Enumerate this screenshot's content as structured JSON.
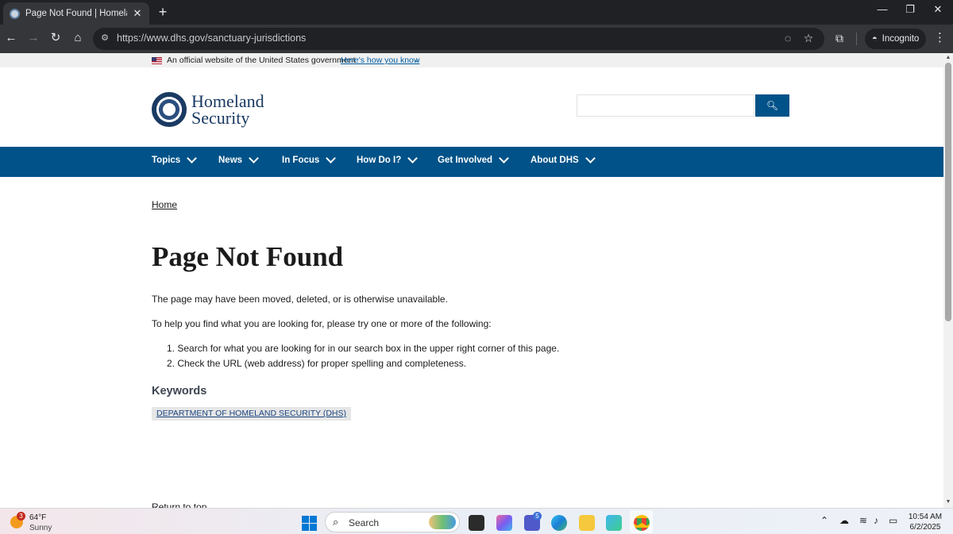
{
  "browser": {
    "tab_title": "Page Not Found | Homeland Security",
    "tab_close": "✕",
    "new_tab": "+",
    "url": "https://www.dhs.gov/sanctuary-jurisdictions",
    "profile_label": "Incognito",
    "window_controls": {
      "minimize": "—",
      "restore": "❐",
      "close": "✕"
    },
    "icons": [
      "back-icon",
      "forward-icon",
      "reload-icon",
      "home-icon",
      "site-info-icon",
      "eye-off-icon",
      "star-icon",
      "tab-search-icon",
      "incognito-icon",
      "menu-icon"
    ]
  },
  "gov_banner": {
    "text": "An official website of the United States government",
    "link": "Here's how you know"
  },
  "header": {
    "logo_line1": "Homeland",
    "logo_line2": "Security",
    "search_placeholder": ""
  },
  "nav": {
    "items": [
      {
        "label": "Topics"
      },
      {
        "label": "News"
      },
      {
        "label": "In Focus"
      },
      {
        "label": "How Do I?"
      },
      {
        "label": "Get Involved"
      },
      {
        "label": "About DHS"
      }
    ]
  },
  "content": {
    "breadcrumb": "Home",
    "title": "Page Not Found",
    "para1": "The page may have been moved, deleted, or is otherwise unavailable.",
    "para2": "To help you find what you are looking for, please try one or more of the following:",
    "list": [
      "1. Search for what you are looking for in our search box in the upper right corner of this page.",
      "2. Check the URL (web address) for proper spelling and completeness."
    ],
    "keywords_heading": "Keywords",
    "keyword_tag": "DEPARTMENT OF HOMELAND SECURITY (DHS)",
    "return_to_top": "Return to top"
  },
  "taskbar": {
    "weather_temp": "64°F",
    "weather_desc": "Sunny",
    "weather_badge": "3",
    "search_label": "Search",
    "teams_badge": "5",
    "time": "10:54 AM",
    "date": "6/2/2025"
  },
  "colors": {
    "nav_blue": "#005288",
    "link_blue": "#005ea2",
    "chrome_dark": "#202124"
  }
}
